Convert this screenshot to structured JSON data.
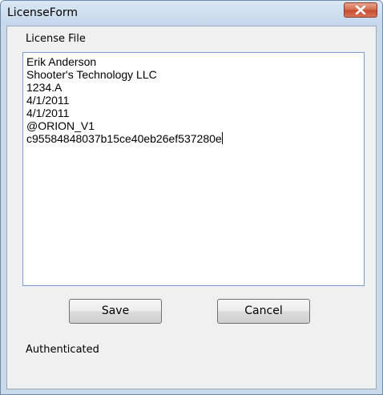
{
  "window": {
    "title": "LicenseForm",
    "close_icon": "close-icon"
  },
  "form": {
    "file_label": "License File",
    "license_lines": [
      "Erik Anderson",
      "Shooter's Technology LLC",
      "1234.A",
      "4/1/2011",
      "4/1/2011",
      "@ORION_V1",
      "c95584848037b15ce40eb26ef537280e"
    ],
    "save_label": "Save",
    "cancel_label": "Cancel",
    "status_text": "Authenticated"
  },
  "colors": {
    "close_button": "#c44a2c",
    "titlebar": "#c4d7ea",
    "textbox_border": "#7a9cd3"
  }
}
